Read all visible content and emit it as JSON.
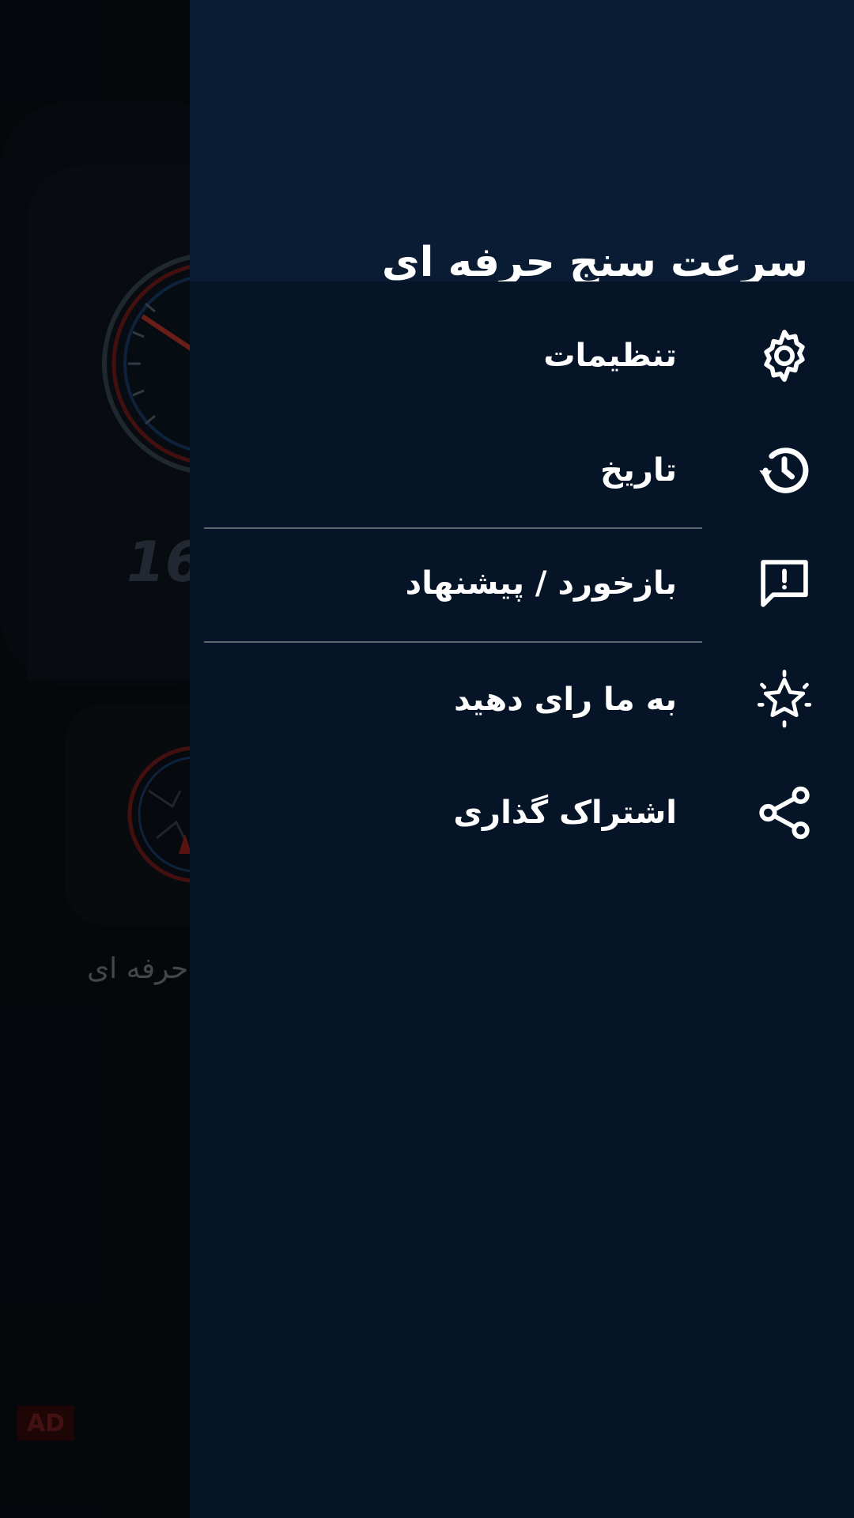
{
  "background": {
    "speed_readout": "16",
    "card_label": "حرفه ای",
    "ad_badge": "AD"
  },
  "drawer": {
    "title": "سرعت سنج حرفه ای",
    "items": [
      {
        "label": "تنظیمات",
        "icon": "gear-icon"
      },
      {
        "label": "تاریخ",
        "icon": "history-icon"
      },
      {
        "label": "بازخورد / پیشنهاد",
        "icon": "feedback-icon"
      },
      {
        "label": "به ما رای دهید",
        "icon": "star-icon"
      },
      {
        "label": "اشتراک گذاری",
        "icon": "share-icon"
      }
    ]
  },
  "colors": {
    "drawer_bg": "#051427",
    "header_bg": "#0a1c33",
    "text": "#ffffff",
    "divider": "#5a6570"
  }
}
